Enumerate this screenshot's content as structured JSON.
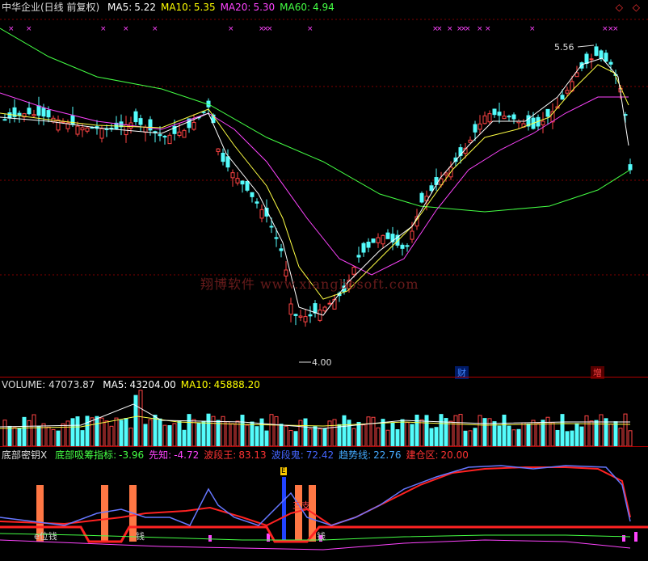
{
  "header": {
    "title": "中华企业(日线 前复权)",
    "items": [
      {
        "label": "MA5:",
        "value": "5.22",
        "color": "#ffffff"
      },
      {
        "label": "MA10:",
        "value": "5.35",
        "color": "#ffff00"
      },
      {
        "label": "MA20:",
        "value": "5.30",
        "color": "#ff44ff"
      },
      {
        "label": "MA60:",
        "value": "4.94",
        "color": "#44ff44"
      }
    ]
  },
  "corner_icons": "◇ ◇",
  "price_labels": {
    "high": "5.56",
    "low": "4.00"
  },
  "markers": {
    "cai": "财",
    "zeng": "增"
  },
  "watermark": "翔博软件 www.xiangbosoft.com",
  "volume_header": {
    "title": "VOLUME:",
    "value": "47073.87",
    "items": [
      {
        "label": "MA5:",
        "value": "43204.00",
        "color": "#ffffff"
      },
      {
        "label": "MA10:",
        "value": "45888.20",
        "color": "#ffff00"
      }
    ]
  },
  "indicator_header": {
    "title": "底部密钥X",
    "items": [
      {
        "label": "底部吸筹指标:",
        "value": "-3.96",
        "color": "#44ff44"
      },
      {
        "label": "先知:",
        "value": "-4.72",
        "color": "#ff44ff"
      },
      {
        "label": "波段王:",
        "value": "83.13",
        "color": "#ff3333"
      },
      {
        "label": "波段鬼:",
        "value": "72.42",
        "color": "#4466ff"
      },
      {
        "label": "趋势线:",
        "value": "22.76",
        "color": "#44aaff"
      },
      {
        "label": "建仓区:",
        "value": "20.00",
        "color": "#ff3333"
      }
    ]
  },
  "indicator_text": {
    "t1": "e位钱",
    "t2": "钱",
    "t3": "钱",
    "t4": "三支",
    "t5": "E"
  }
}
